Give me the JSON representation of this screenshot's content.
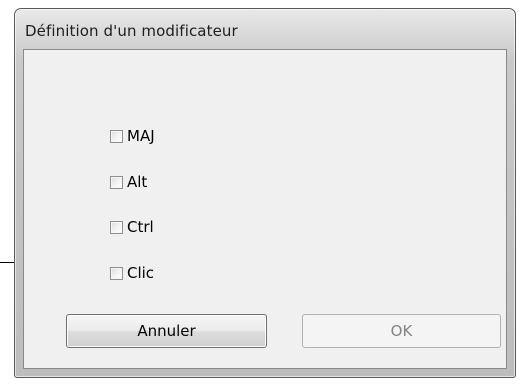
{
  "window": {
    "title": "Définition d'un modificateur"
  },
  "checkboxes": [
    {
      "label": "MAJ",
      "checked": false
    },
    {
      "label": "Alt",
      "checked": false
    },
    {
      "label": "Ctrl",
      "checked": false
    },
    {
      "label": "Clic",
      "checked": false
    }
  ],
  "buttons": {
    "cancel_label": "Annuler",
    "ok_label": "OK",
    "ok_enabled": false
  }
}
